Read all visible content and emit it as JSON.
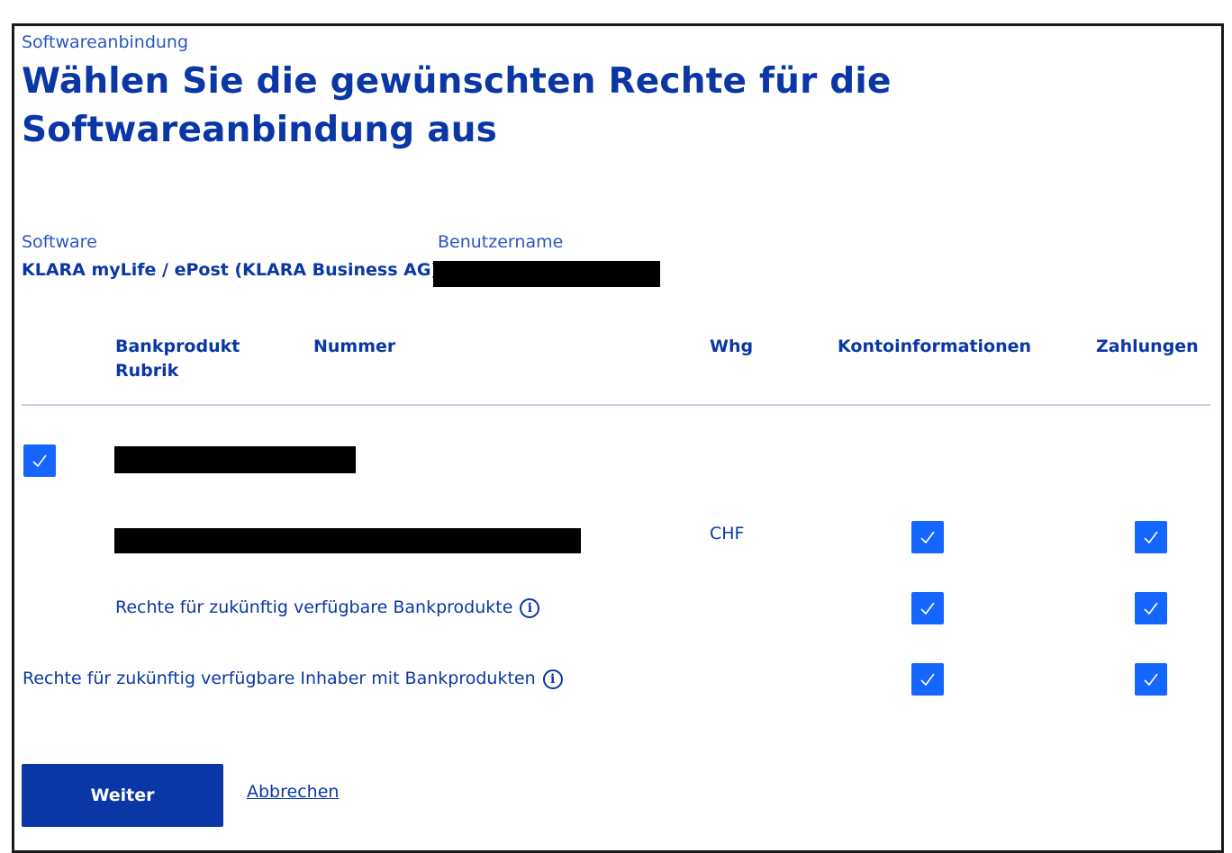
{
  "breadcrumb": "Softwareanbindung",
  "title": "Wählen Sie die gewünschten Rechte für die Softwareanbindung aus",
  "software": {
    "label": "Software",
    "value": "KLARA myLife / ePost (KLARA Business AG)"
  },
  "username": {
    "label": "Benutzername"
  },
  "table": {
    "headers": {
      "bankprodukt": "Bankprodukt",
      "rubrik": "Rubrik",
      "nummer": "Nummer",
      "whg": "Whg",
      "kontoinformationen": "Kontoinformationen",
      "zahlungen": "Zahlungen"
    },
    "account_row": {
      "currency": "CHF",
      "kontoinformationen_checked": true,
      "zahlungen_checked": true
    },
    "future_products": {
      "label": "Rechte für zukünftig verfügbare Bankprodukte",
      "kontoinformationen_checked": true,
      "zahlungen_checked": true
    },
    "future_holders": {
      "label": "Rechte für zukünftig verfügbare Inhaber mit Bankprodukten",
      "kontoinformationen_checked": true,
      "zahlungen_checked": true
    },
    "holder_checked": true
  },
  "info_glyph": "i",
  "buttons": {
    "weiter": "Weiter",
    "abbrechen": "Abbrechen"
  },
  "colors": {
    "primary": "#0a37a5",
    "checkbox": "#1565ff",
    "divider": "#c7d2ea"
  }
}
